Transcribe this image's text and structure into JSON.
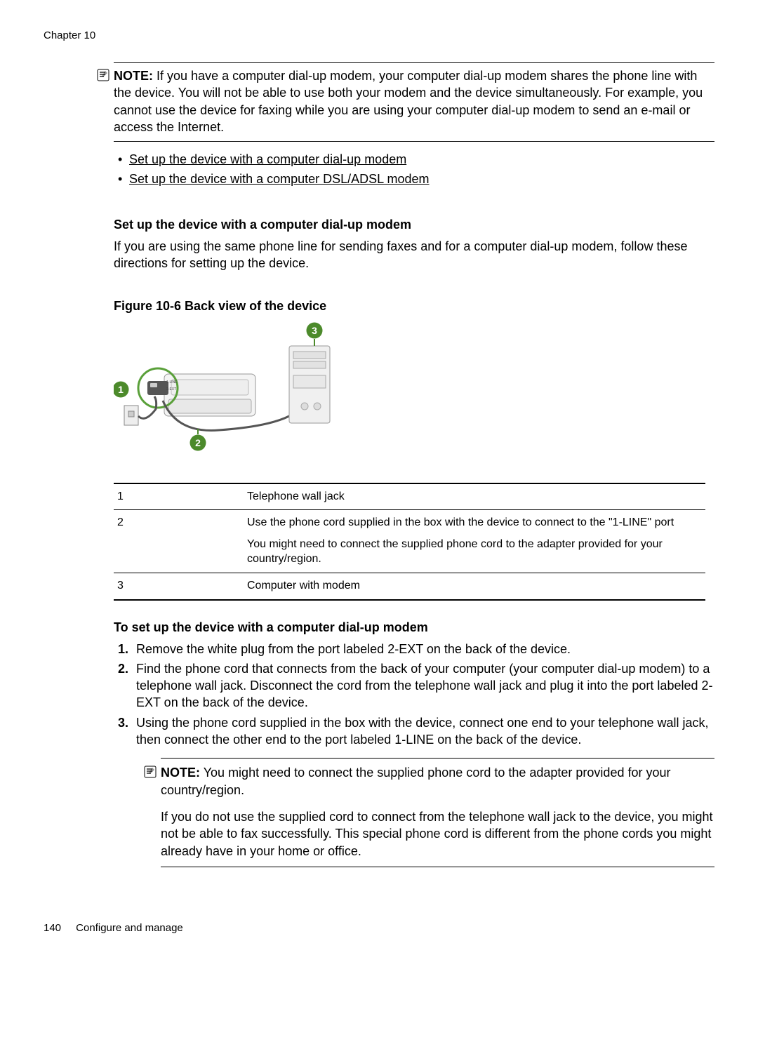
{
  "header": "Chapter 10",
  "note1": {
    "label": "NOTE:",
    "text": "If you have a computer dial-up modem, your computer dial-up modem shares the phone line with the device. You will not be able to use both your modem and the device simultaneously. For example, you cannot use the device for faxing while you are using your computer dial-up modem to send an e-mail or access the Internet."
  },
  "links": [
    "Set up the device with a computer dial-up modem",
    "Set up the device with a computer DSL/ADSL modem"
  ],
  "section_heading": "Set up the device with a computer dial-up modem",
  "section_body": "If you are using the same phone line for sending faxes and for a computer dial-up modem, follow these directions for setting up the device.",
  "figure_caption": "Figure 10-6 Back view of the device",
  "table": [
    {
      "num": "1",
      "text": "Telephone wall jack"
    },
    {
      "num": "2",
      "text": "Use the phone cord supplied in the box with the device to connect to the \"1-LINE\" port",
      "text2": "You might need to connect the supplied phone cord to the adapter provided for your country/region."
    },
    {
      "num": "3",
      "text": "Computer with modem"
    }
  ],
  "steps_heading": "To set up the device with a computer dial-up modem",
  "steps": [
    "Remove the white plug from the port labeled 2-EXT on the back of the device.",
    "Find the phone cord that connects from the back of your computer (your computer dial-up modem) to a telephone wall jack. Disconnect the cord from the telephone wall jack and plug it into the port labeled 2-EXT on the back of the device.",
    "Using the phone cord supplied in the box with the device, connect one end to your telephone wall jack, then connect the other end to the port labeled 1-LINE on the back of the device."
  ],
  "note2": {
    "label": "NOTE:",
    "text": "You might need to connect the supplied phone cord to the adapter provided for your country/region.",
    "para2": "If you do not use the supplied cord to connect from the telephone wall jack to the device, you might not be able to fax successfully. This special phone cord is different from the phone cords you might already have in your home or office."
  },
  "footer": {
    "pagenum": "140",
    "section": "Configure and manage"
  }
}
